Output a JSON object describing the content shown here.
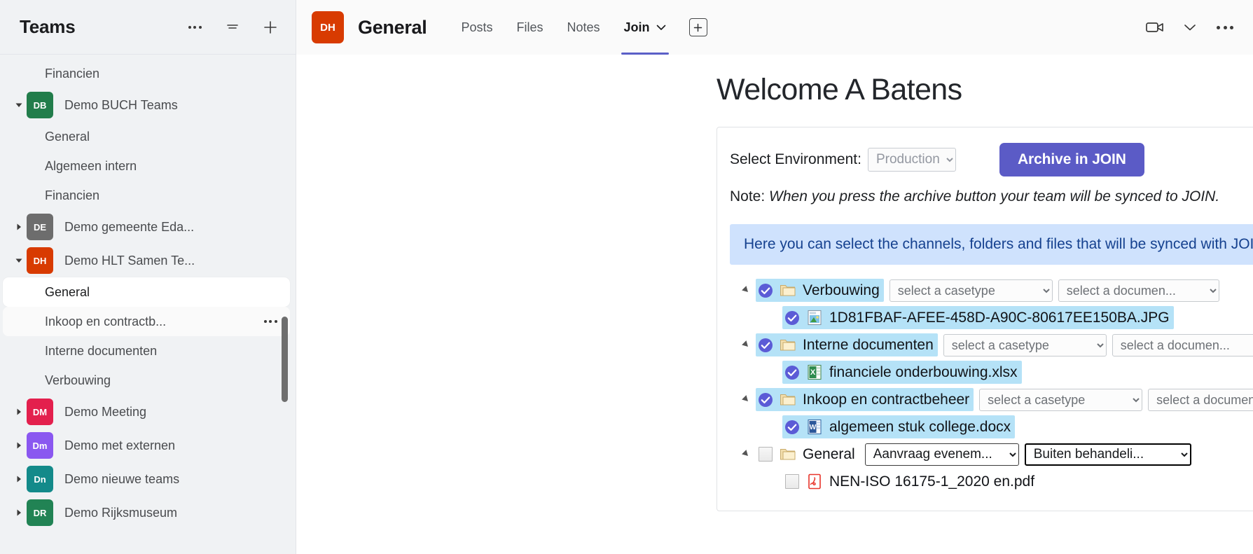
{
  "sidebar": {
    "title": "Teams",
    "header_actions": [
      {
        "name": "more-options-icon",
        "label": "More options"
      },
      {
        "name": "filter-icon",
        "label": "Filter"
      },
      {
        "name": "add-icon",
        "label": "Add team"
      }
    ],
    "items": [
      {
        "type": "channel",
        "label": "Financien",
        "state": "normal"
      },
      {
        "type": "team",
        "label": "Demo BUCH Teams",
        "initials": "DB",
        "color": "#227d4b",
        "expanded": true
      },
      {
        "type": "channel",
        "label": "General",
        "state": "normal"
      },
      {
        "type": "channel",
        "label": "Algemeen intern",
        "state": "normal"
      },
      {
        "type": "channel",
        "label": "Financien",
        "state": "normal"
      },
      {
        "type": "team",
        "label": "Demo gemeente Eda...",
        "initials": "DE",
        "color": "#6d6d6d",
        "expanded": false
      },
      {
        "type": "team",
        "label": "Demo HLT Samen Te...",
        "initials": "DH",
        "color": "#d83b01",
        "expanded": true
      },
      {
        "type": "channel",
        "label": "General",
        "state": "selected"
      },
      {
        "type": "channel",
        "label": "Inkoop en contractb...",
        "state": "hovered",
        "has_overflow": true
      },
      {
        "type": "channel",
        "label": "Interne documenten",
        "state": "normal"
      },
      {
        "type": "channel",
        "label": "Verbouwing",
        "state": "normal"
      },
      {
        "type": "team",
        "label": "Demo Meeting",
        "initials": "DM",
        "color": "#e3204d",
        "expanded": false
      },
      {
        "type": "team",
        "label": "Demo met externen",
        "initials": "Dm",
        "color": "#8a57f0",
        "expanded": false
      },
      {
        "type": "team",
        "label": "Demo nieuwe teams",
        "initials": "Dn",
        "color": "#138a8a",
        "expanded": false
      },
      {
        "type": "team",
        "label": "Demo Rijksmuseum",
        "initials": "DR",
        "color": "#218354",
        "expanded": false
      }
    ]
  },
  "header": {
    "avatar_initials": "DH",
    "avatar_color": "#d83b01",
    "channel_title": "General",
    "tabs": [
      {
        "label": "Posts",
        "active": false
      },
      {
        "label": "Files",
        "active": false
      },
      {
        "label": "Notes",
        "active": false
      },
      {
        "label": "Join",
        "active": true,
        "has_chevron": true
      }
    ],
    "add_tab_label": "+",
    "right_icons": [
      {
        "name": "video-call-icon"
      },
      {
        "name": "chevron-down-icon"
      },
      {
        "name": "more-options-icon"
      }
    ]
  },
  "page": {
    "title": "Welcome A Batens",
    "env_label": "Select Environment:",
    "env_value": "Production",
    "env_options": [
      "Production"
    ],
    "archive_button": "Archive in JOIN",
    "note_prefix": "Note: ",
    "note_text": "When you press the archive button your team will be synced to JOIN.",
    "info_bar": "Here you can select the channels, folders and files that will be synced with JOIN.",
    "accent_purple": "#5b5bc6",
    "info_bg": "#cfe2fd",
    "info_fg": "#15418f",
    "selection_highlight": "#b5e2f7"
  },
  "tree": {
    "placeholder_casetype": "select a casetype",
    "placeholder_document": "select a documen...",
    "rows": [
      {
        "level": 0,
        "kind": "folder",
        "label": "Verbouwing",
        "checked": true,
        "highlighted": true,
        "expanded": true,
        "casetype": "select a casetype",
        "doctype": "select a documen...",
        "casetype_state": "placeholder",
        "doctype_state": "placeholder"
      },
      {
        "level": 1,
        "kind": "image-file",
        "label": "1D81FBAF-AFEE-458D-A90C-80617EE150BA.JPG",
        "checked": true,
        "highlighted": true
      },
      {
        "level": 0,
        "kind": "folder",
        "label": "Interne documenten",
        "checked": true,
        "highlighted": true,
        "expanded": true,
        "casetype": "select a casetype",
        "doctype": "select a documen...",
        "casetype_state": "placeholder",
        "doctype_state": "placeholder"
      },
      {
        "level": 1,
        "kind": "excel-file",
        "label": "financiele onderbouwing.xlsx",
        "checked": true,
        "highlighted": true
      },
      {
        "level": 0,
        "kind": "folder",
        "label": "Inkoop en contractbeheer",
        "checked": true,
        "highlighted": true,
        "expanded": true,
        "casetype": "select a casetype",
        "doctype": "select a documen...",
        "casetype_state": "placeholder",
        "doctype_state": "placeholder"
      },
      {
        "level": 1,
        "kind": "word-file",
        "label": "algemeen stuk college.docx",
        "checked": true,
        "highlighted": true
      },
      {
        "level": 0,
        "kind": "folder",
        "label": "General",
        "checked": false,
        "highlighted": false,
        "expanded": true,
        "casetype": "Aanvraag evenem...",
        "doctype": "Buiten behandeli...",
        "casetype_state": "filled",
        "doctype_state": "focused"
      },
      {
        "level": 1,
        "kind": "pdf-file",
        "label": "NEN-ISO 16175-1_2020 en.pdf",
        "checked": false,
        "highlighted": false
      }
    ]
  }
}
